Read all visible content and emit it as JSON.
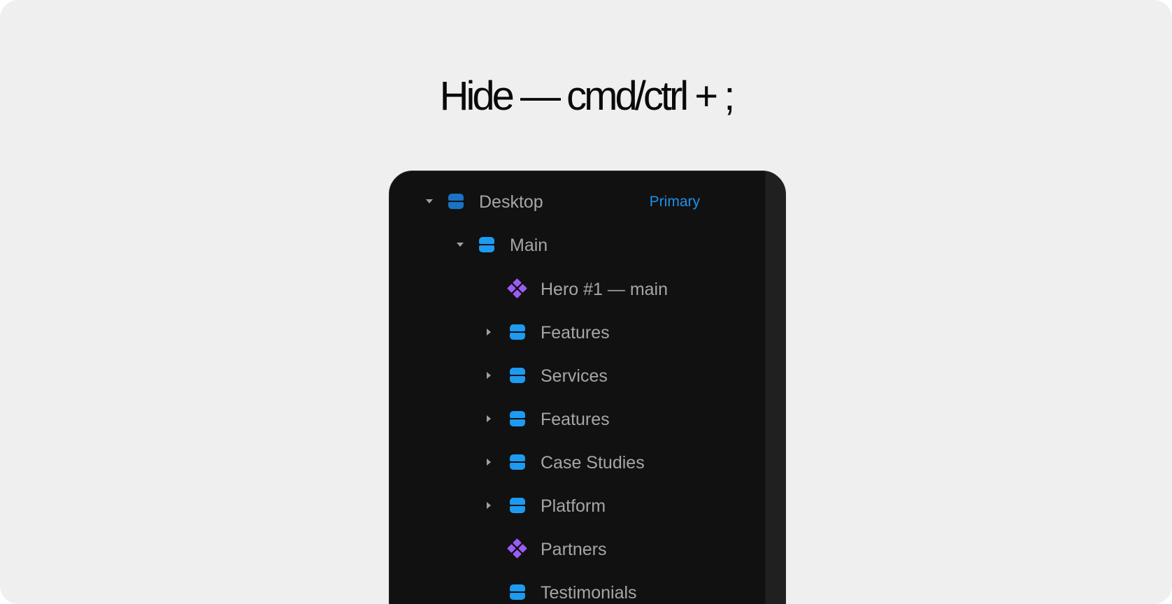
{
  "headline": "Hide — cmd/ctrl + ;",
  "layers": {
    "desktop": {
      "label": "Desktop",
      "badge": "Primary",
      "icon": "frame-icon"
    },
    "main": {
      "label": "Main",
      "icon": "frame-icon"
    },
    "items": [
      {
        "label": "Hero #1 — main",
        "icon": "component-icon"
      },
      {
        "label": "Features",
        "icon": "frame-icon"
      },
      {
        "label": "Services",
        "icon": "frame-icon"
      },
      {
        "label": "Features",
        "icon": "frame-icon"
      },
      {
        "label": "Case Studies",
        "icon": "frame-icon"
      },
      {
        "label": "Platform",
        "icon": "frame-icon"
      },
      {
        "label": "Partners",
        "icon": "component-icon"
      },
      {
        "label": "Testimonials",
        "icon": "frame-icon"
      }
    ]
  },
  "colors": {
    "frame": "#1d9bf0",
    "component": "#9b5cf6",
    "badge": "#1e90e8",
    "panel": "#111111",
    "background": "#efefef"
  }
}
